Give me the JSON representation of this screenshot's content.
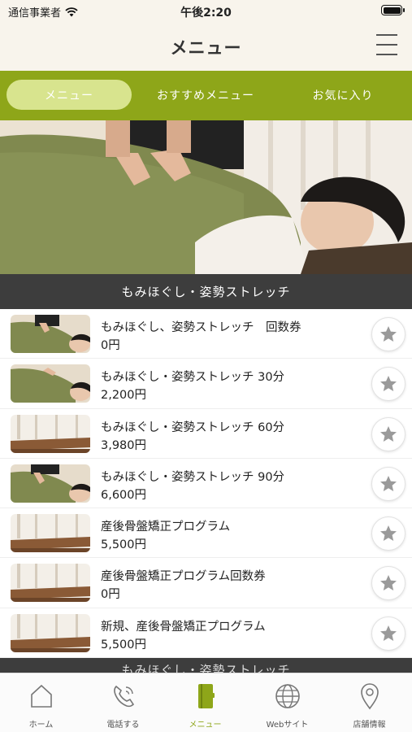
{
  "status_bar": {
    "carrier": "通信事業者",
    "time": "午後2:20"
  },
  "header": {
    "title": "メニュー"
  },
  "tabs": [
    {
      "label": "メニュー",
      "active": true
    },
    {
      "label": "おすすめメニュー",
      "active": false
    },
    {
      "label": "お気に入り",
      "active": false
    }
  ],
  "section": {
    "title": "もみほぐし・姿勢ストレッチ"
  },
  "items": [
    {
      "name": "もみほぐし、姿勢ストレッチ　回数券",
      "price": "0円",
      "thumb": "massage-photo"
    },
    {
      "name": "もみほぐし・姿勢ストレッチ 30分",
      "price": "2,200円",
      "thumb": "massage-photo"
    },
    {
      "name": "もみほぐし・姿勢ストレッチ 60分",
      "price": "3,980円",
      "thumb": "room-photo"
    },
    {
      "name": "もみほぐし・姿勢ストレッチ 90分",
      "price": "6,600円",
      "thumb": "massage-photo"
    },
    {
      "name": "産後骨盤矯正プログラム",
      "price": "5,500円",
      "thumb": "room-photo"
    },
    {
      "name": "産後骨盤矯正プログラム回数券",
      "price": "0円",
      "thumb": "room-photo"
    },
    {
      "name": "新規、産後骨盤矯正プログラム",
      "price": "5,500円",
      "thumb": "room-photo"
    }
  ],
  "next_section": {
    "title": "もみほぐし・姿勢ストレッチ"
  },
  "bottom_nav": [
    {
      "label": "ホーム",
      "icon": "home-icon",
      "active": false
    },
    {
      "label": "電話する",
      "icon": "phone-icon",
      "active": false
    },
    {
      "label": "メニュー",
      "icon": "book-icon",
      "active": true
    },
    {
      "label": "Webサイト",
      "icon": "globe-icon",
      "active": false
    },
    {
      "label": "店舗情報",
      "icon": "location-pin-icon",
      "active": false
    }
  ],
  "colors": {
    "accent": "#8ea619",
    "accent_light": "#d8e48e",
    "header_bg": "#f8f4ec",
    "section_bg": "#3d3d3d"
  }
}
